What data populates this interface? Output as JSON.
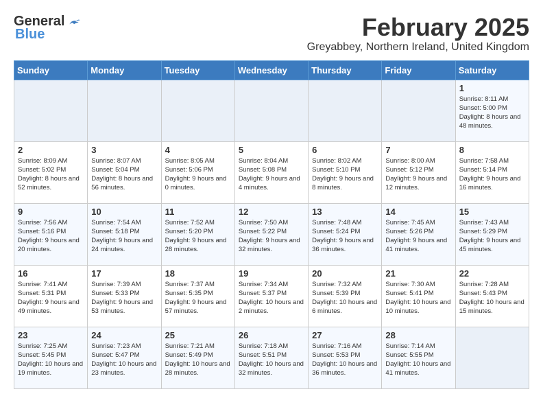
{
  "logo": {
    "general": "General",
    "blue": "Blue"
  },
  "title": "February 2025",
  "location": "Greyabbey, Northern Ireland, United Kingdom",
  "weekdays": [
    "Sunday",
    "Monday",
    "Tuesday",
    "Wednesday",
    "Thursday",
    "Friday",
    "Saturday"
  ],
  "weeks": [
    [
      {
        "day": "",
        "info": ""
      },
      {
        "day": "",
        "info": ""
      },
      {
        "day": "",
        "info": ""
      },
      {
        "day": "",
        "info": ""
      },
      {
        "day": "",
        "info": ""
      },
      {
        "day": "",
        "info": ""
      },
      {
        "day": "1",
        "info": "Sunrise: 8:11 AM\nSunset: 5:00 PM\nDaylight: 8 hours and 48 minutes."
      }
    ],
    [
      {
        "day": "2",
        "info": "Sunrise: 8:09 AM\nSunset: 5:02 PM\nDaylight: 8 hours and 52 minutes."
      },
      {
        "day": "3",
        "info": "Sunrise: 8:07 AM\nSunset: 5:04 PM\nDaylight: 8 hours and 56 minutes."
      },
      {
        "day": "4",
        "info": "Sunrise: 8:05 AM\nSunset: 5:06 PM\nDaylight: 9 hours and 0 minutes."
      },
      {
        "day": "5",
        "info": "Sunrise: 8:04 AM\nSunset: 5:08 PM\nDaylight: 9 hours and 4 minutes."
      },
      {
        "day": "6",
        "info": "Sunrise: 8:02 AM\nSunset: 5:10 PM\nDaylight: 9 hours and 8 minutes."
      },
      {
        "day": "7",
        "info": "Sunrise: 8:00 AM\nSunset: 5:12 PM\nDaylight: 9 hours and 12 minutes."
      },
      {
        "day": "8",
        "info": "Sunrise: 7:58 AM\nSunset: 5:14 PM\nDaylight: 9 hours and 16 minutes."
      }
    ],
    [
      {
        "day": "9",
        "info": "Sunrise: 7:56 AM\nSunset: 5:16 PM\nDaylight: 9 hours and 20 minutes."
      },
      {
        "day": "10",
        "info": "Sunrise: 7:54 AM\nSunset: 5:18 PM\nDaylight: 9 hours and 24 minutes."
      },
      {
        "day": "11",
        "info": "Sunrise: 7:52 AM\nSunset: 5:20 PM\nDaylight: 9 hours and 28 minutes."
      },
      {
        "day": "12",
        "info": "Sunrise: 7:50 AM\nSunset: 5:22 PM\nDaylight: 9 hours and 32 minutes."
      },
      {
        "day": "13",
        "info": "Sunrise: 7:48 AM\nSunset: 5:24 PM\nDaylight: 9 hours and 36 minutes."
      },
      {
        "day": "14",
        "info": "Sunrise: 7:45 AM\nSunset: 5:26 PM\nDaylight: 9 hours and 41 minutes."
      },
      {
        "day": "15",
        "info": "Sunrise: 7:43 AM\nSunset: 5:29 PM\nDaylight: 9 hours and 45 minutes."
      }
    ],
    [
      {
        "day": "16",
        "info": "Sunrise: 7:41 AM\nSunset: 5:31 PM\nDaylight: 9 hours and 49 minutes."
      },
      {
        "day": "17",
        "info": "Sunrise: 7:39 AM\nSunset: 5:33 PM\nDaylight: 9 hours and 53 minutes."
      },
      {
        "day": "18",
        "info": "Sunrise: 7:37 AM\nSunset: 5:35 PM\nDaylight: 9 hours and 57 minutes."
      },
      {
        "day": "19",
        "info": "Sunrise: 7:34 AM\nSunset: 5:37 PM\nDaylight: 10 hours and 2 minutes."
      },
      {
        "day": "20",
        "info": "Sunrise: 7:32 AM\nSunset: 5:39 PM\nDaylight: 10 hours and 6 minutes."
      },
      {
        "day": "21",
        "info": "Sunrise: 7:30 AM\nSunset: 5:41 PM\nDaylight: 10 hours and 10 minutes."
      },
      {
        "day": "22",
        "info": "Sunrise: 7:28 AM\nSunset: 5:43 PM\nDaylight: 10 hours and 15 minutes."
      }
    ],
    [
      {
        "day": "23",
        "info": "Sunrise: 7:25 AM\nSunset: 5:45 PM\nDaylight: 10 hours and 19 minutes."
      },
      {
        "day": "24",
        "info": "Sunrise: 7:23 AM\nSunset: 5:47 PM\nDaylight: 10 hours and 23 minutes."
      },
      {
        "day": "25",
        "info": "Sunrise: 7:21 AM\nSunset: 5:49 PM\nDaylight: 10 hours and 28 minutes."
      },
      {
        "day": "26",
        "info": "Sunrise: 7:18 AM\nSunset: 5:51 PM\nDaylight: 10 hours and 32 minutes."
      },
      {
        "day": "27",
        "info": "Sunrise: 7:16 AM\nSunset: 5:53 PM\nDaylight: 10 hours and 36 minutes."
      },
      {
        "day": "28",
        "info": "Sunrise: 7:14 AM\nSunset: 5:55 PM\nDaylight: 10 hours and 41 minutes."
      },
      {
        "day": "",
        "info": ""
      }
    ]
  ]
}
